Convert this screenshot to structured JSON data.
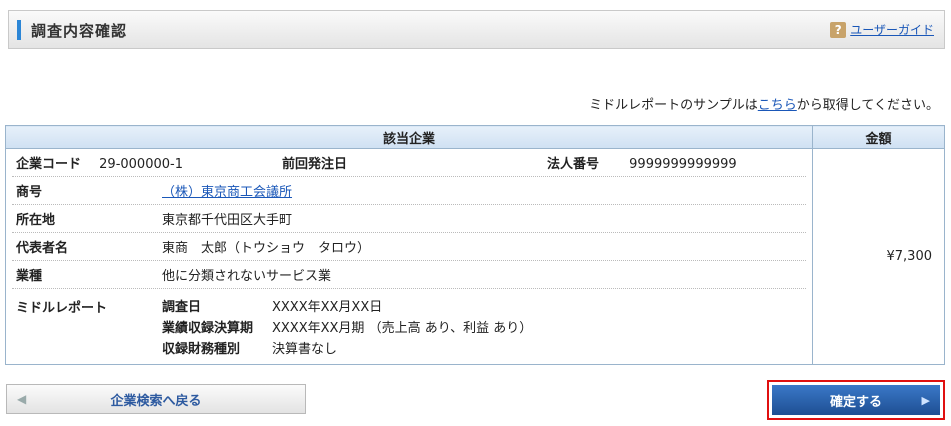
{
  "header": {
    "title": "調査内容確認",
    "guide_link": "ユーザーガイド",
    "guide_icon": "question-icon"
  },
  "notice": {
    "prefix": "ミドルレポートのサンプルは",
    "link": "こちら",
    "suffix": "から取得してください。"
  },
  "table": {
    "col_company": "該当企業",
    "col_amount": "金額",
    "amount_value": "¥7,300",
    "company_code_label": "企業コード",
    "company_code": "29-000000-1",
    "last_order_label": "前回発注日",
    "last_order_value": "",
    "corp_number_label": "法人番号",
    "corp_number": "9999999999999",
    "trade_name_label": "商号",
    "trade_name": "（株）東京商工会議所",
    "address_label": "所在地",
    "address": "東京都千代田区大手町",
    "rep_label": "代表者名",
    "rep_value": "東商　太郎（トウショウ　タロウ）",
    "industry_label": "業種",
    "industry_value": "他に分類されないサービス業",
    "middle_report_label": "ミドルレポート",
    "survey_date_label": "調査日",
    "survey_date": "XXXX年XX月XX日",
    "results_label": "業績収録決算期",
    "results_value": "XXXX年XX月期 （売上高 あり、利益 あり）",
    "fin_type_label": "収録財務種別",
    "fin_type_value": "決算書なし"
  },
  "buttons": {
    "back": "企業検索へ戻る",
    "confirm": "確定する"
  }
}
